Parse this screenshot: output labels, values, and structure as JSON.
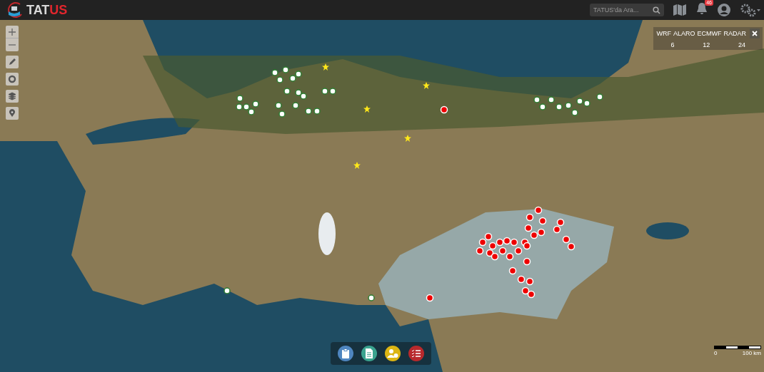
{
  "header": {
    "logo_main": "TAT",
    "logo_accent": "US",
    "search": {
      "placeholder": "TATUS'da Ara..."
    },
    "notifications": {
      "count": "46"
    }
  },
  "map_controls": [
    {
      "kind": "zoom-in"
    },
    {
      "kind": "zoom-out"
    },
    {
      "kind": "draw"
    },
    {
      "kind": "target"
    },
    {
      "kind": "layers"
    },
    {
      "kind": "marker"
    }
  ],
  "forecast_panel": {
    "models": [
      "WRF",
      "ALARO",
      "ECMWF",
      "RADAR"
    ],
    "steps": [
      "6",
      "12",
      "24"
    ]
  },
  "scale": {
    "start": "0",
    "end": "100 km"
  },
  "action_bar": [
    {
      "kind": "report",
      "color": "#4f86c0"
    },
    {
      "kind": "document",
      "color": "#3aa38f"
    },
    {
      "kind": "user",
      "color": "#dcb513"
    },
    {
      "kind": "checklist",
      "color": "#b8292c"
    }
  ]
}
